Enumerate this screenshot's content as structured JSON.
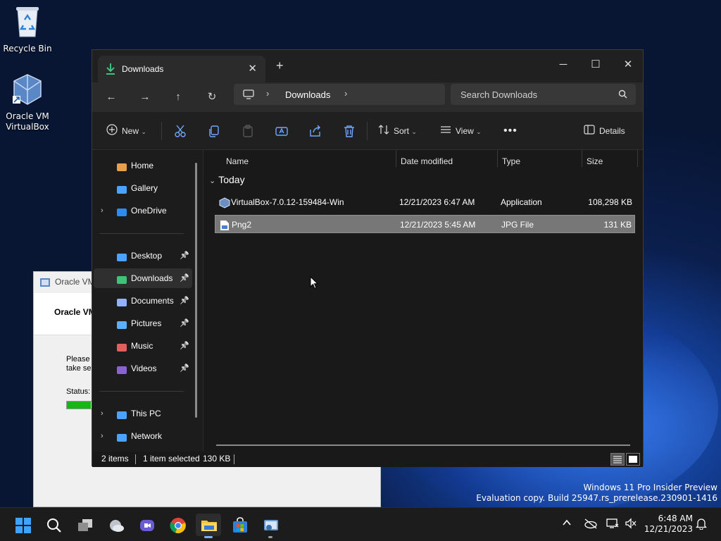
{
  "desktop": {
    "icons": [
      {
        "label": "Recycle Bin"
      },
      {
        "label": "Oracle VM VirtualBox"
      }
    ]
  },
  "installer": {
    "title": "Oracle VM",
    "header": "Oracle VM",
    "body_line1": "Please w",
    "body_line2": "take se",
    "status_label": "Status:",
    "progress_fraction": 0.9
  },
  "explorer": {
    "tab_title": "Downloads",
    "address": {
      "crumb": "Downloads"
    },
    "search_placeholder": "Search Downloads",
    "toolbar": {
      "new_label": "New",
      "sort_label": "Sort",
      "view_label": "View",
      "details_label": "Details"
    },
    "sidebar": {
      "items": [
        {
          "label": "Home",
          "icon": "home-icon"
        },
        {
          "label": "Gallery",
          "icon": "gallery-icon"
        },
        {
          "label": "OneDrive",
          "icon": "onedrive-icon"
        },
        {
          "label": "Desktop",
          "icon": "desktop-folder-icon"
        },
        {
          "label": "Downloads",
          "icon": "downloads-folder-icon"
        },
        {
          "label": "Documents",
          "icon": "documents-folder-icon"
        },
        {
          "label": "Pictures",
          "icon": "pictures-folder-icon"
        },
        {
          "label": "Music",
          "icon": "music-folder-icon"
        },
        {
          "label": "Videos",
          "icon": "videos-folder-icon"
        },
        {
          "label": "This PC",
          "icon": "this-pc-icon"
        },
        {
          "label": "Network",
          "icon": "network-icon"
        }
      ]
    },
    "columns": [
      "Name",
      "Date modified",
      "Type",
      "Size"
    ],
    "group_label": "Today",
    "files": [
      {
        "name": "VirtualBox-7.0.12-159484-Win",
        "date": "12/21/2023 6:47 AM",
        "type": "Application",
        "size": "108,298 KB",
        "selected": false
      },
      {
        "name": "Png2",
        "date": "12/21/2023 5:45 AM",
        "type": "JPG File",
        "size": "131 KB",
        "selected": true
      }
    ],
    "status": {
      "count": "2 items",
      "selection": "1 item selected",
      "selection_size": "130 KB"
    }
  },
  "watermark": {
    "line1": "Windows 11 Pro Insider Preview",
    "line2": "Evaluation copy. Build 25947.rs_prerelease.230901-1416"
  },
  "taskbar": {
    "time": "6:48 AM",
    "date": "12/21/2023"
  },
  "colors": {
    "accent": "#6fa8ff",
    "window_bg": "#191919",
    "selected_row": "#777777",
    "progress": "#18b518"
  }
}
